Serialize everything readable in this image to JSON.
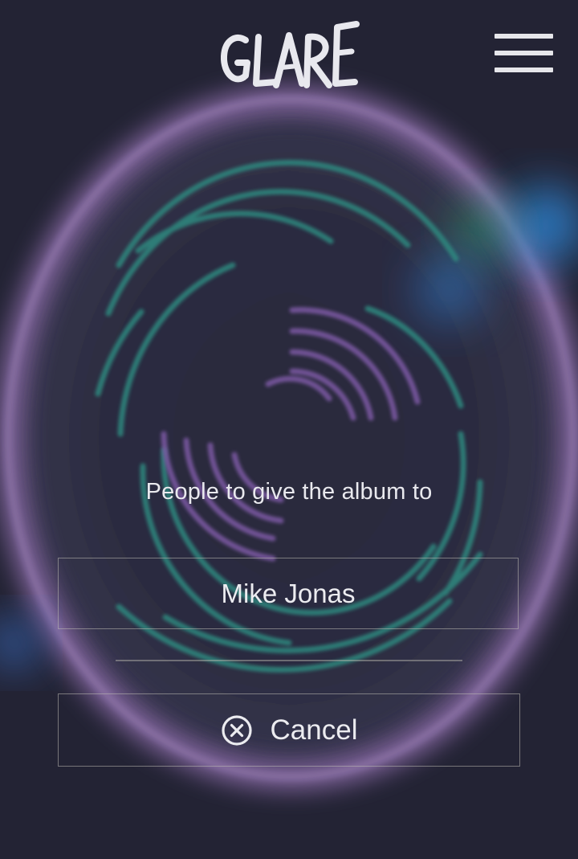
{
  "app": {
    "logo_text": "GLARE"
  },
  "header": {
    "menu_icon": "hamburger-menu-icon"
  },
  "main": {
    "prompt": "People to give the album to",
    "recipient_value": "Mike Jonas",
    "cancel_label": "Cancel",
    "cancel_icon": "close-circle-icon"
  },
  "colors": {
    "background": "#232334",
    "ring_purple": "#a77fd0",
    "ring_teal": "#2f8a80",
    "glow_blue": "#2f7fcf",
    "text": "#ececf0",
    "border": "#9e9c94"
  }
}
